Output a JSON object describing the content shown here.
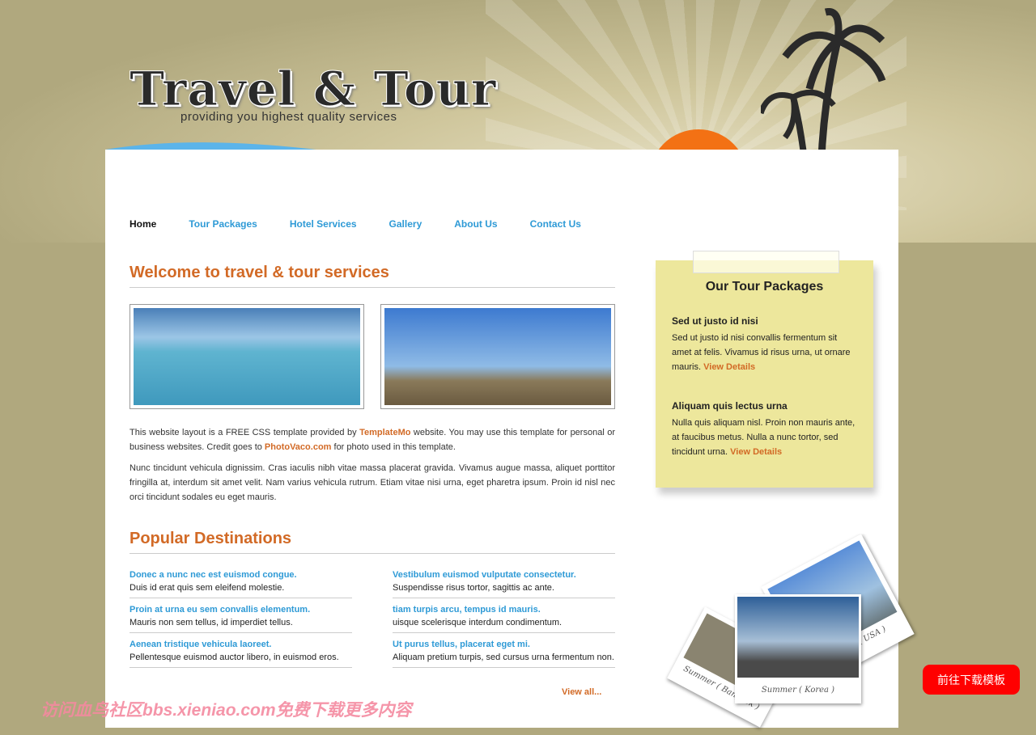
{
  "header": {
    "logo": "Travel & Tour",
    "slogan": "providing you highest quality services"
  },
  "nav": [
    {
      "label": "Home"
    },
    {
      "label": "Tour Packages"
    },
    {
      "label": "Hotel Services"
    },
    {
      "label": "Gallery"
    },
    {
      "label": "About Us"
    },
    {
      "label": "Contact Us"
    }
  ],
  "welcome": {
    "title": "Welcome to travel & tour services",
    "p1_a": "This website layout is a FREE CSS template provided by ",
    "p1_link1": "TemplateMo",
    "p1_b": " website. You may use this template for personal or business websites. Credit goes to ",
    "p1_link2": "PhotoVaco.com",
    "p1_c": " for photo used in this template.",
    "p2": "Nunc tincidunt vehicula dignissim. Cras iaculis nibh vitae massa placerat gravida. Vivamus augue massa, aliquet porttitor fringilla at, interdum sit amet velit. Nam varius vehicula rutrum. Etiam vitae nisi urna, eget pharetra ipsum. Proin id nisl nec orci tincidunt sodales eu eget mauris."
  },
  "destinations": {
    "title": "Popular Destinations",
    "view_all": "View all...",
    "items": [
      {
        "title": "Donec a nunc nec est euismod congue.",
        "text": "Duis id erat quis sem eleifend molestie."
      },
      {
        "title": "Vestibulum euismod vulputate consectetur.",
        "text": "Suspendisse risus tortor, sagittis ac ante."
      },
      {
        "title": "Proin at urna eu sem convallis elementum.",
        "text": "Mauris non sem tellus, id imperdiet tellus."
      },
      {
        "title": "tiam turpis arcu, tempus id mauris.",
        "text": "uisque scelerisque interdum condimentum."
      },
      {
        "title": "Aenean tristique vehicula laoreet.",
        "text": "Pellentesque euismod auctor libero, in euismod eros."
      },
      {
        "title": "Ut purus tellus, placerat eget mi.",
        "text": "Aliquam pretium turpis, sed cursus urna fermentum non."
      }
    ]
  },
  "sidebar": {
    "title": "Our Tour Packages",
    "packages": [
      {
        "title": "Sed ut justo id nisi",
        "text": "Sed ut justo id nisi convallis fermentum sit amet at felis. Vivamus id risus urna, ut ornare mauris. ",
        "link": "View Details"
      },
      {
        "title": "Aliquam quis lectus urna",
        "text": "Nulla quis aliquam nisl. Proin non mauris ante, at faucibus metus. Nulla a nunc tortor, sed tincidunt urna. ",
        "link": "View Details"
      }
    ]
  },
  "gallery_captions": [
    "Summer ( Korea )",
    "Summer ( USA )",
    "Summer ( Bangkok )"
  ],
  "cta": "前往下载模板",
  "watermark": "访问血鸟社区bbs.xieniao.com免费下载更多内容",
  "colors": {
    "accent": "#d26a26",
    "link": "#2e9ad6",
    "note": "#ede79c",
    "cta": "#ff0000"
  }
}
